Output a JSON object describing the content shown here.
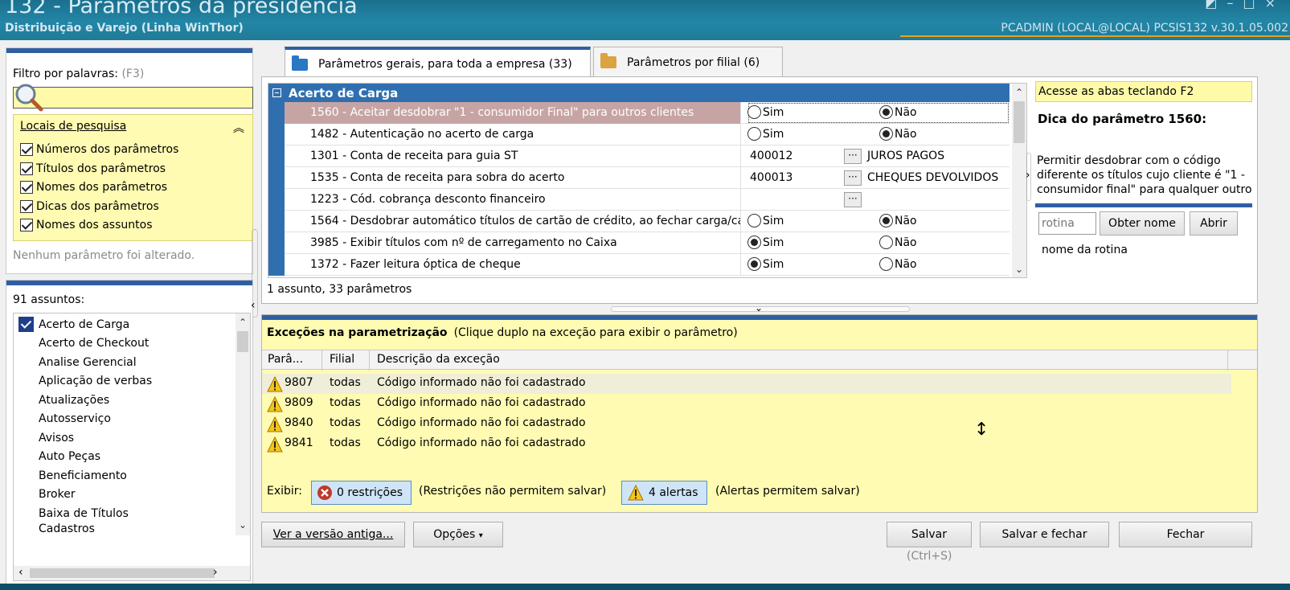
{
  "window": {
    "title": "132 - Parâmetros da presidência",
    "subtitle": "Distribuição e Varejo (Linha WinThor)",
    "user_info": "PCADMIN (LOCAL@LOCAL)   PCSIS132  v.30.1.05.002"
  },
  "filter": {
    "label": "Filtro por palavras:",
    "shortcut": "(F3)",
    "value": "",
    "search_places_title": "Locais de pesquisa",
    "options": [
      {
        "label": "Números dos parâmetros",
        "checked": true
      },
      {
        "label": "Títulos dos parâmetros",
        "checked": true
      },
      {
        "label": "Nomes dos parâmetros",
        "checked": true
      },
      {
        "label": "Dicas dos parâmetros",
        "checked": true
      },
      {
        "label": "Nomes dos assuntos",
        "checked": true
      }
    ],
    "no_change_msg": "Nenhum parâmetro foi alterado."
  },
  "subjects": {
    "count_label": "91 assuntos:",
    "items": [
      {
        "label": "Acerto de Carga",
        "checked": true
      },
      {
        "label": "Acerto de Checkout",
        "checked": false
      },
      {
        "label": "Analise Gerencial",
        "checked": false
      },
      {
        "label": "Aplicação de verbas",
        "checked": false
      },
      {
        "label": "Atualizações",
        "checked": false
      },
      {
        "label": "Autosserviço",
        "checked": false
      },
      {
        "label": "Avisos",
        "checked": false
      },
      {
        "label": "Auto Peças",
        "checked": false
      },
      {
        "label": "Beneficiamento",
        "checked": false
      },
      {
        "label": "Broker",
        "checked": false
      },
      {
        "label": "Baixa de Títulos",
        "checked": false
      },
      {
        "label": "Cadastros",
        "checked": false
      }
    ]
  },
  "tabs": [
    {
      "label": "Parâmetros gerais, para toda a empresa",
      "count": "(33)",
      "active": true,
      "color": "#2b78c2"
    },
    {
      "label": "Parâmetros por filial",
      "count": "(6)",
      "active": false,
      "color": "#d9a441"
    }
  ],
  "params": {
    "group": "Acerto de Carga",
    "rows": [
      {
        "name": "1560 - Aceitar desdobrar \"1 - consumidor Final\" para outros clientes",
        "type": "radio",
        "sim": false,
        "nao": true,
        "selected": true
      },
      {
        "name": "1482 - Autenticação no acerto de carga",
        "type": "radio",
        "sim": false,
        "nao": true
      },
      {
        "name": "1301 - Conta de receita para guia ST",
        "type": "lookup",
        "code": "400012",
        "desc": "JUROS PAGOS"
      },
      {
        "name": "1535 - Conta de receita para sobra do acerto",
        "type": "lookup",
        "code": "400013",
        "desc": "CHEQUES DEVOLVIDOS"
      },
      {
        "name": "1223 - Cód. cobrança desconto financeiro",
        "type": "lookup",
        "code": "",
        "desc": ""
      },
      {
        "name": "1564 - Desdobrar automático títulos de cartão de crédito, ao fechar carga/ca",
        "type": "radio",
        "sim": false,
        "nao": true
      },
      {
        "name": "3985 - Exibir títulos com nº de carregamento no Caixa",
        "type": "radio",
        "sim": true,
        "nao": false
      },
      {
        "name": "1372 - Fazer leitura óptica de cheque",
        "type": "radio",
        "sim": true,
        "nao": false
      }
    ],
    "sim_label": "Sim",
    "nao_label": "Não",
    "lookup_button": "···",
    "summary": "1 assunto, 33 parâmetros"
  },
  "tip": {
    "header": "Acesse as abas teclando F2",
    "title": "Dica do parâmetro 1560:",
    "text": "Permitir desdobrar com o código diferente os títulos cujo cliente é \"1 - consumidor final\" para qualquer outro",
    "rotina_placeholder": "rotina",
    "get_name_button": "Obter nome",
    "open_button": "Abrir",
    "rotina_label": "nome da rotina"
  },
  "exceptions": {
    "title": "Exceções na parametrização",
    "hint": "(Clique duplo na exceção para exibir o parâmetro)",
    "columns": [
      "Parâ...",
      "Filial",
      "Descrição da exceção"
    ],
    "rows": [
      {
        "param": "9807",
        "filial": "todas",
        "desc": "Código informado não foi cadastrado"
      },
      {
        "param": "9809",
        "filial": "todas",
        "desc": "Código informado não foi cadastrado"
      },
      {
        "param": "9840",
        "filial": "todas",
        "desc": "Código informado não foi cadastrado"
      },
      {
        "param": "9841",
        "filial": "todas",
        "desc": "Código informado não foi cadastrado"
      }
    ],
    "show_label": "Exibir:",
    "restrictions": "0 restrições",
    "restrictions_note": "(Restrições não permitem salvar)",
    "alerts": "4 alertas",
    "alerts_note": "(Alertas permitem salvar)"
  },
  "footer": {
    "old_version": "Ver a versão antiga...",
    "options": "Opções",
    "save": "Salvar",
    "save_close": "Salvar e fechar",
    "close": "Fechar",
    "save_shortcut": "(Ctrl+S)"
  },
  "colors": {
    "accent_blue": "#2f5fa2",
    "highlight_yellow": "#fffbb2",
    "warning": "#f5c518",
    "error": "#c0392b"
  }
}
